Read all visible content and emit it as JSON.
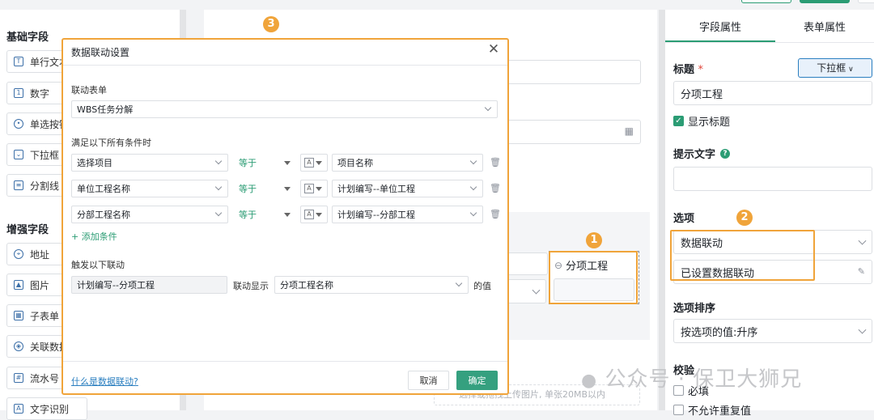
{
  "left": {
    "section_basic": "基础字段",
    "basic_fields": [
      {
        "label": "单行文本",
        "icon": "text-field-icon"
      },
      {
        "label": "数字",
        "icon": "number-field-icon"
      },
      {
        "label": "单选按钮",
        "icon": "radio-field-icon"
      },
      {
        "label": "下拉框",
        "icon": "dropdown-field-icon"
      },
      {
        "label": "分割线",
        "icon": "divider-field-icon"
      }
    ],
    "section_enhanced": "增强字段",
    "enhanced_fields": [
      {
        "label": "地址",
        "icon": "location-icon"
      },
      {
        "label": "图片",
        "icon": "image-icon"
      },
      {
        "label": "子表单",
        "icon": "subform-icon"
      },
      {
        "label": "关联数据",
        "icon": "link-data-icon"
      },
      {
        "label": "流水号",
        "icon": "serial-number-icon"
      },
      {
        "label": "文字识别",
        "icon": "ocr-icon"
      }
    ]
  },
  "canvas": {
    "linked_field_label": "分项工程",
    "upload_hint": "选择或拖拽上传图片, 单张20MB以内"
  },
  "right": {
    "tabs": [
      "字段属性",
      "表单属性"
    ],
    "title_label": "标题",
    "required_mark": "*",
    "type_button": "下拉框",
    "title_value": "分项工程",
    "show_title_label": "显示标题",
    "hint_label": "提示文字",
    "options_label": "选项",
    "options_mode": "数据联动",
    "options_status": "已设置数据联动",
    "sort_label": "选项排序",
    "sort_value": "按选项的值:升序",
    "validate_label": "校验",
    "required_label": "必填",
    "no_dup_label": "不允许重复值"
  },
  "modal": {
    "title": "数据联动设置",
    "linked_form_label": "联动表单",
    "linked_form_value": "WBS任务分解",
    "conditions_label": "满足以下所有条件时",
    "conditions": [
      {
        "field": "选择项目",
        "operator": "等于",
        "value": "项目名称"
      },
      {
        "field": "单位工程名称",
        "operator": "等于",
        "value": "计划编写--单位工程"
      },
      {
        "field": "分部工程名称",
        "operator": "等于",
        "value": "计划编写--分部工程"
      }
    ],
    "add_condition": "+ 添加条件",
    "trigger_label": "触发以下联动",
    "trigger_target": "计划编写--分项工程",
    "trigger_show": "联动显示",
    "trigger_field": "分项工程名称",
    "trigger_suffix": "的值",
    "help_link": "什么是数据联动?",
    "cancel": "取消",
    "confirm": "确定"
  },
  "callouts": [
    "1",
    "2",
    "3"
  ],
  "watermark": "公众号 · 保卫大狮兄",
  "colors": {
    "accent": "#2b9c74",
    "highlight": "#f0a43a",
    "link": "#2b7fc0"
  }
}
